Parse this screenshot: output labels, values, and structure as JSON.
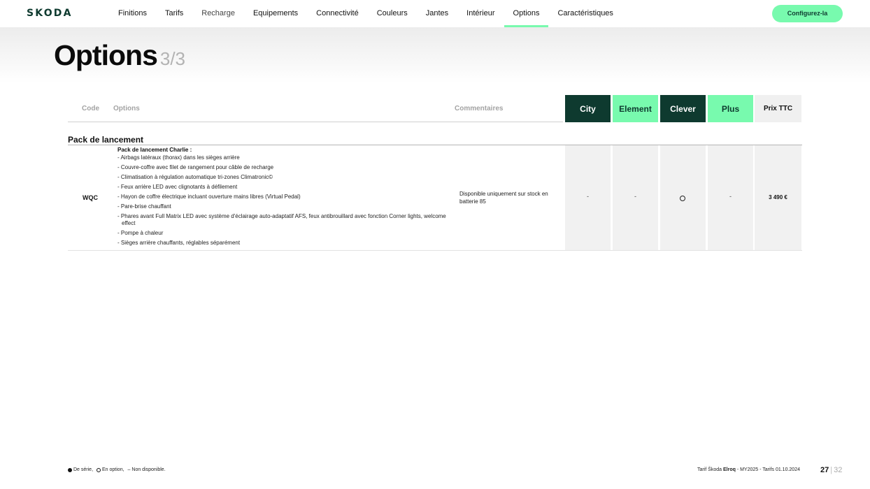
{
  "brand": {
    "logo": "SKODA"
  },
  "nav": {
    "items": [
      {
        "label": "Finitions"
      },
      {
        "label": "Tarifs"
      },
      {
        "label": "Recharge"
      },
      {
        "label": "Equipements"
      },
      {
        "label": "Connectivité"
      },
      {
        "label": "Couleurs"
      },
      {
        "label": "Jantes"
      },
      {
        "label": "Intérieur"
      },
      {
        "label": "Options"
      },
      {
        "label": "Caractéristiques"
      }
    ],
    "active": "Options",
    "cta_label": "Configurez-la"
  },
  "page": {
    "title": "Options",
    "subtitle": "3/3"
  },
  "table": {
    "headers": {
      "code": "Code",
      "options": "Options",
      "comments": "Commentaires"
    },
    "variants": [
      {
        "label": "City"
      },
      {
        "label": "Element"
      },
      {
        "label": "Clever"
      },
      {
        "label": "Plus"
      },
      {
        "label": "Prix TTC"
      }
    ],
    "section": {
      "title": "Pack de lancement",
      "rows": [
        {
          "code": "WQC",
          "option_title": "Pack de lancement Charlie :",
          "option_lines": [
            "- Airbags latéraux (thorax) dans les sièges arrière",
            "- Couvre-coffre avec filet de rangement pour câble de recharge",
            "- Climatisation à régulation automatique tri-zones Climatronic©",
            "- Feux arrière LED avec clignotants à défilement",
            "- Hayon de coffre électrique incluant ouverture mains libres (Virtual Pedal)",
            "- Pare-brise chauffant",
            "- Phares avant Full Matrix LED avec système d'éclairage auto-adaptatif AFS, feux antibrouillard avec fonction Corner lights, welcome effect",
            "- Pompe à chaleur",
            "- Sièges arrière chauffants, réglables séparément"
          ],
          "comment": "Disponible uniquement sur stock en batterie 85",
          "availability": {
            "city": "-",
            "element": "-",
            "clever": "option",
            "plus": "-"
          },
          "price": "3 490 €"
        }
      ]
    }
  },
  "footer": {
    "legend": {
      "standard": "De série,",
      "option": "En option,",
      "unavailable": "– Non disponible."
    },
    "doc_prefix": "Tarif Škoda",
    "doc_model": "Elroq",
    "doc_suffix": "- MY2025 - Tarifs 01.10.2024",
    "page_current": "27",
    "page_sep": "|",
    "page_total": "32"
  },
  "colors": {
    "brand_dark": "#0e3a2f",
    "brand_accent": "#78faae",
    "price_bg": "#f0f0f0"
  },
  "icons": {
    "option_marker": "circle-outline-icon",
    "standard_marker": "circle-filled-icon"
  }
}
